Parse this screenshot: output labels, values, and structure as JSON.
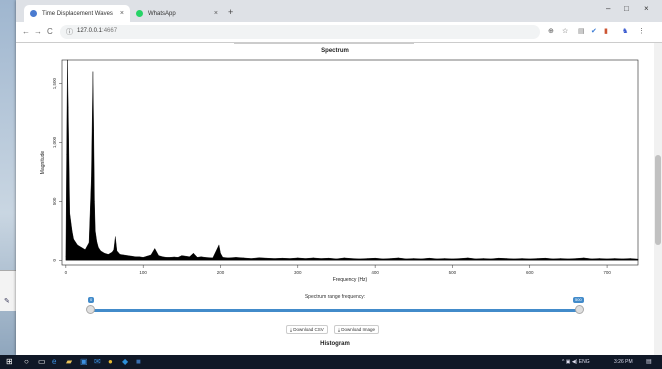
{
  "browser": {
    "tabs": [
      {
        "label": "Time Displacement Waves",
        "active": true,
        "favicon_color": "#4a7bd0"
      },
      {
        "label": "WhatsApp",
        "active": false,
        "favicon_color": "#25d366"
      }
    ],
    "new_tab_glyph": "+",
    "tab_close_glyph": "×",
    "window_controls": [
      "–",
      "□",
      "×"
    ],
    "nav": {
      "back": "←",
      "forward": "→",
      "reload": "C"
    },
    "address": {
      "host": "127.0.0.1",
      "path": ":4667"
    },
    "toolbar_icons": [
      "zoom-icon",
      "star-icon",
      "extension-icon",
      "check-icon",
      "bookmark-icon",
      "profile-icon",
      "menu-icon"
    ]
  },
  "page": {
    "spectrum_title": "Spectrum",
    "slider": {
      "label": "Spectrum range frequency:",
      "min_badge": "0",
      "max_badge": "500",
      "accent": "#428bca"
    },
    "buttons": {
      "download_csv": "Download CSV",
      "download_image": "Download Image"
    },
    "histogram_title": "Histogram"
  },
  "chart_data": {
    "type": "area",
    "title": "Spectrum",
    "xlabel": "Frequency (Hz)",
    "ylabel": "Magnitude",
    "x_ticks": [
      "0",
      "100",
      "200",
      "300",
      "400",
      "500",
      "600",
      "700"
    ],
    "y_ticks": [
      "0",
      "500",
      "1,000",
      "1,500"
    ],
    "xlim": [
      -5,
      740
    ],
    "ylim": [
      -40,
      1700
    ],
    "grid": false,
    "series": [
      {
        "color": "#000000",
        "x": [
          0,
          1,
          2,
          3,
          5,
          8,
          10,
          15,
          20,
          25,
          30,
          33,
          35,
          36,
          37,
          38,
          40,
          42,
          45,
          50,
          55,
          60,
          62,
          64,
          66,
          70,
          75,
          80,
          85,
          90,
          95,
          100,
          105,
          110,
          115,
          120,
          125,
          130,
          135,
          140,
          145,
          150,
          160,
          165,
          170,
          175,
          180,
          190,
          198,
          200,
          203,
          210,
          220,
          230,
          240,
          250,
          260,
          270,
          280,
          290,
          300,
          310,
          320,
          330,
          340,
          350,
          360,
          370,
          380,
          390,
          400,
          410,
          420,
          430,
          440,
          450,
          460,
          470,
          480,
          490,
          500,
          510,
          520,
          530,
          540,
          550,
          560,
          570,
          580,
          590,
          600,
          610,
          620,
          630,
          640,
          650,
          660,
          670,
          680,
          690,
          700,
          710,
          720,
          730,
          740
        ],
        "values": [
          30,
          900,
          1700,
          1300,
          400,
          250,
          180,
          130,
          110,
          90,
          150,
          700,
          1600,
          1100,
          500,
          250,
          160,
          110,
          80,
          60,
          50,
          70,
          90,
          200,
          80,
          50,
          45,
          40,
          35,
          30,
          30,
          25,
          35,
          45,
          100,
          40,
          30,
          25,
          25,
          28,
          25,
          40,
          30,
          60,
          25,
          30,
          25,
          20,
          130,
          60,
          25,
          20,
          25,
          20,
          15,
          22,
          18,
          15,
          18,
          15,
          20,
          15,
          20,
          15,
          18,
          12,
          20,
          15,
          12,
          15,
          18,
          12,
          15,
          20,
          12,
          15,
          12,
          18,
          12,
          15,
          12,
          15,
          20,
          12,
          15,
          12,
          18,
          15,
          12,
          15,
          12,
          15,
          18,
          12,
          15,
          12,
          15,
          20,
          12,
          15,
          12,
          15,
          12,
          15,
          10
        ]
      }
    ]
  },
  "taskbar": {
    "start": "⊞",
    "items": [
      {
        "name": "search-icon",
        "glyph": "○",
        "color": "#ffffff"
      },
      {
        "name": "task-view-icon",
        "glyph": "▭",
        "color": "#ffffff"
      },
      {
        "name": "edge-icon",
        "glyph": "e",
        "color": "#3b8fe0"
      },
      {
        "name": "file-explorer-icon",
        "glyph": "▰",
        "color": "#e8c25a"
      },
      {
        "name": "store-icon",
        "glyph": "▣",
        "color": "#3b8fe0"
      },
      {
        "name": "mail-icon",
        "glyph": "✉",
        "color": "#3b8fe0"
      },
      {
        "name": "chrome-icon",
        "glyph": "●",
        "color": "#e6b932"
      },
      {
        "name": "vscode-icon",
        "glyph": "◆",
        "color": "#2d8fd8"
      },
      {
        "name": "app-icon",
        "glyph": "■",
        "color": "#3a6fb0"
      }
    ],
    "tray_text": "^  ▣  ◀)  ENG",
    "time": "3:26 PM"
  }
}
